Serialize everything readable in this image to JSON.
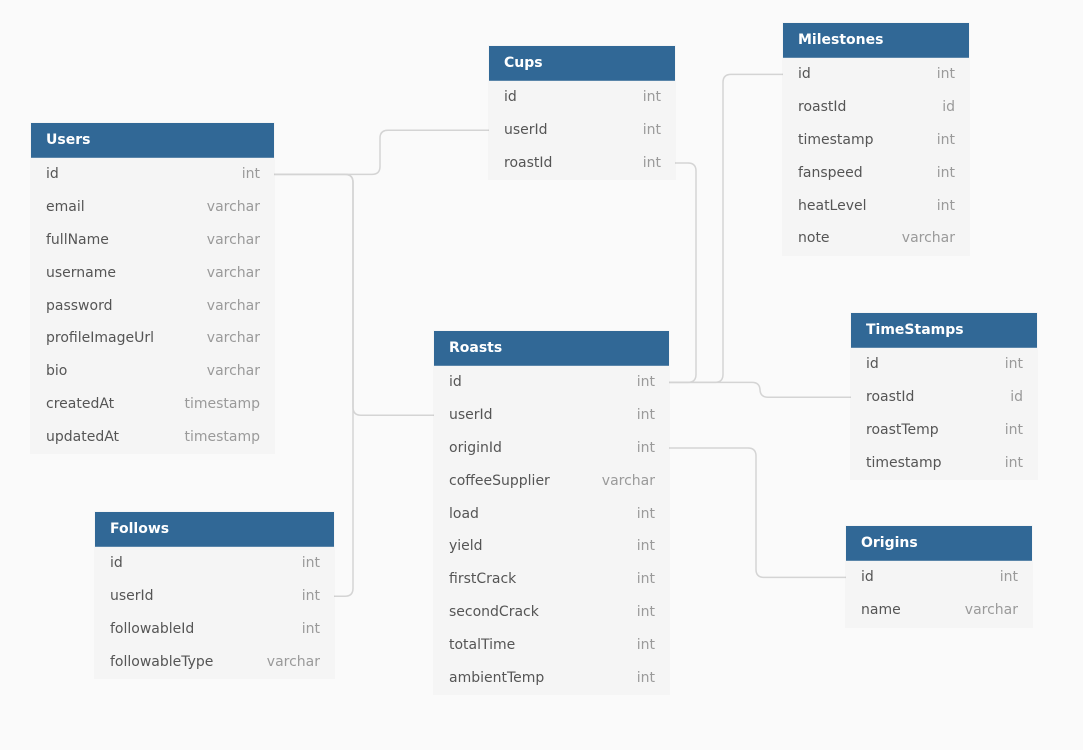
{
  "diagram": {
    "header_color": "#316896",
    "tables": [
      {
        "id": "users",
        "name": "Users",
        "fields": [
          {
            "name": "id",
            "type": "int"
          },
          {
            "name": "email",
            "type": "varchar"
          },
          {
            "name": "fullName",
            "type": "varchar"
          },
          {
            "name": "username",
            "type": "varchar"
          },
          {
            "name": "password",
            "type": "varchar"
          },
          {
            "name": "profileImageUrl",
            "type": "varchar"
          },
          {
            "name": "bio",
            "type": "varchar"
          },
          {
            "name": "createdAt",
            "type": "timestamp"
          },
          {
            "name": "updatedAt",
            "type": "timestamp"
          }
        ]
      },
      {
        "id": "cups",
        "name": "Cups",
        "fields": [
          {
            "name": "id",
            "type": "int"
          },
          {
            "name": "userId",
            "type": "int"
          },
          {
            "name": "roastId",
            "type": "int"
          }
        ]
      },
      {
        "id": "milestones",
        "name": "Milestones",
        "fields": [
          {
            "name": "id",
            "type": "int"
          },
          {
            "name": "roastId",
            "type": "id"
          },
          {
            "name": "timestamp",
            "type": "int"
          },
          {
            "name": "fanspeed",
            "type": "int"
          },
          {
            "name": "heatLevel",
            "type": "int"
          },
          {
            "name": "note",
            "type": "varchar"
          }
        ]
      },
      {
        "id": "roasts",
        "name": "Roasts",
        "fields": [
          {
            "name": "id",
            "type": "int"
          },
          {
            "name": "userId",
            "type": "int"
          },
          {
            "name": "originId",
            "type": "int"
          },
          {
            "name": "coffeeSupplier",
            "type": "varchar"
          },
          {
            "name": "load",
            "type": "int"
          },
          {
            "name": "yield",
            "type": "int"
          },
          {
            "name": "firstCrack",
            "type": "int"
          },
          {
            "name": "secondCrack",
            "type": "int"
          },
          {
            "name": "totalTime",
            "type": "int"
          },
          {
            "name": "ambientTemp",
            "type": "int"
          }
        ]
      },
      {
        "id": "timestamps",
        "name": "TimeStamps",
        "fields": [
          {
            "name": "id",
            "type": "int"
          },
          {
            "name": "roastId",
            "type": "id"
          },
          {
            "name": "roastTemp",
            "type": "int"
          },
          {
            "name": "timestamp",
            "type": "int"
          }
        ]
      },
      {
        "id": "follows",
        "name": "Follows",
        "fields": [
          {
            "name": "id",
            "type": "int"
          },
          {
            "name": "userId",
            "type": "int"
          },
          {
            "name": "followableId",
            "type": "int"
          },
          {
            "name": "followableType",
            "type": "varchar"
          }
        ]
      },
      {
        "id": "origins",
        "name": "Origins",
        "fields": [
          {
            "name": "id",
            "type": "int"
          },
          {
            "name": "name",
            "type": "varchar"
          }
        ]
      }
    ],
    "relationships": [
      {
        "from": "users.id",
        "to": "cups.userId"
      },
      {
        "from": "users.id",
        "to": "roasts.userId"
      },
      {
        "from": "users.id",
        "to": "follows.userId"
      },
      {
        "from": "roasts.id",
        "to": "cups.roastId"
      },
      {
        "from": "roasts.id",
        "to": "milestones.roastId"
      },
      {
        "from": "roasts.id",
        "to": "timestamps.roastId"
      },
      {
        "from": "roasts.originId",
        "to": "origins.id"
      }
    ]
  }
}
